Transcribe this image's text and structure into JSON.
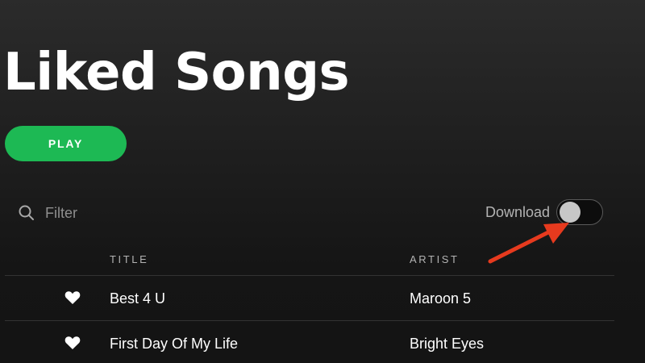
{
  "header": {
    "title": "Liked Songs",
    "play_label": "PLAY"
  },
  "filter": {
    "placeholder": "Filter",
    "icon": "search-icon"
  },
  "download": {
    "label": "Download",
    "enabled": false
  },
  "annotation": {
    "arrow_color": "#e63a1e"
  },
  "table": {
    "columns": [
      "TITLE",
      "ARTIST"
    ],
    "rows": [
      {
        "liked": true,
        "title": "Best 4 U",
        "artist": "Maroon 5"
      },
      {
        "liked": true,
        "title": "First Day Of My Life",
        "artist": "Bright Eyes"
      }
    ]
  },
  "colors": {
    "accent": "#1db954",
    "background": "#181818"
  }
}
